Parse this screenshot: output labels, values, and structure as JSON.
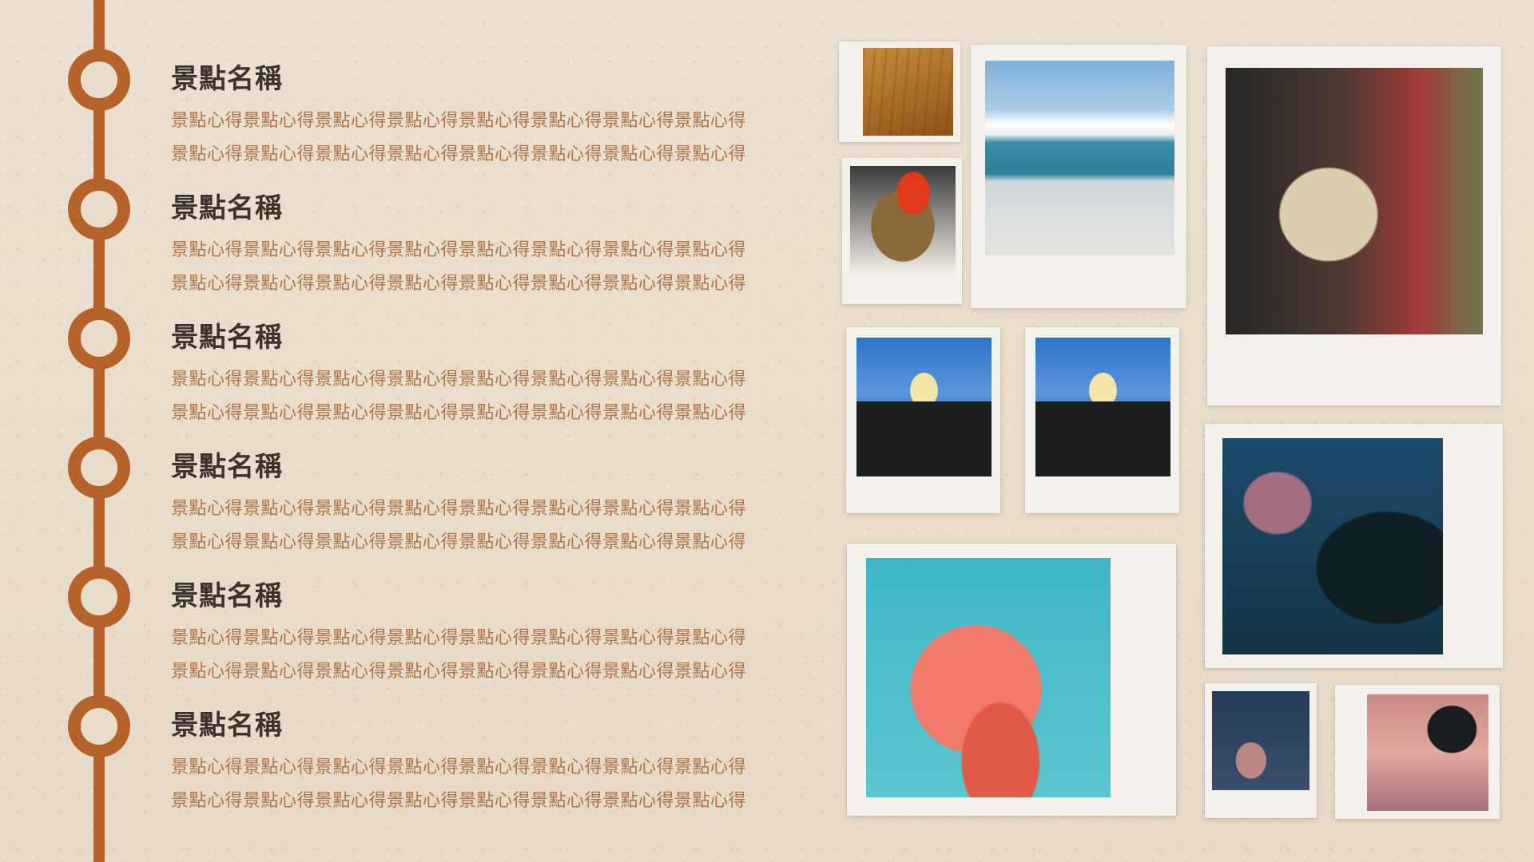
{
  "timeline": {
    "entries": [
      {
        "title": "景點名稱",
        "lines": [
          "景點心得景點心得景點心得景點心得景點心得景點心得景點心得景點心得",
          "景點心得景點心得景點心得景點心得景點心得景點心得景點心得景點心得"
        ]
      },
      {
        "title": "景點名稱",
        "lines": [
          "景點心得景點心得景點心得景點心得景點心得景點心得景點心得景點心得",
          "景點心得景點心得景點心得景點心得景點心得景點心得景點心得景點心得"
        ]
      },
      {
        "title": "景點名稱",
        "lines": [
          "景點心得景點心得景點心得景點心得景點心得景點心得景點心得景點心得",
          "景點心得景點心得景點心得景點心得景點心得景點心得景點心得景點心得"
        ]
      },
      {
        "title": "景點名稱",
        "lines": [
          "景點心得景點心得景點心得景點心得景點心得景點心得景點心得景點心得",
          "景點心得景點心得景點心得景點心得景點心得景點心得景點心得景點心得"
        ]
      },
      {
        "title": "景點名稱",
        "lines": [
          "景點心得景點心得景點心得景點心得景點心得景點心得景點心得景點心得",
          "景點心得景點心得景點心得景點心得景點心得景點心得景點心得景點心得"
        ]
      },
      {
        "title": "景點名稱",
        "lines": [
          "景點心得景點心得景點心得景點心得景點心得景點心得景點心得景點心得",
          "景點心得景點心得景點心得景點心得景點心得景點心得景點心得景點心得"
        ]
      }
    ]
  },
  "colors": {
    "background": "#e9ddcc",
    "accent_rail": "#b5632b",
    "title_text": "#3b332d",
    "body_text": "#a9764f",
    "frame": "#f4f1ec"
  },
  "photos": [
    {
      "name": "wood-photo",
      "subject": "wood texture"
    },
    {
      "name": "beach-photo",
      "subject": "beach and sea"
    },
    {
      "name": "food-photo",
      "subject": "rice bowl"
    },
    {
      "name": "bubble-tea-photo",
      "subject": "bubble tea cup"
    },
    {
      "name": "town-photo-1",
      "subject": "street and sky"
    },
    {
      "name": "town-photo-2",
      "subject": "street and sky"
    },
    {
      "name": "palm-photo",
      "subject": "palm tree at dusk"
    },
    {
      "name": "coral-photo",
      "subject": "coral and fish"
    },
    {
      "name": "sky-photo",
      "subject": "evening sky"
    },
    {
      "name": "palm-pink-photo",
      "subject": "palm leaves pink sky"
    }
  ]
}
